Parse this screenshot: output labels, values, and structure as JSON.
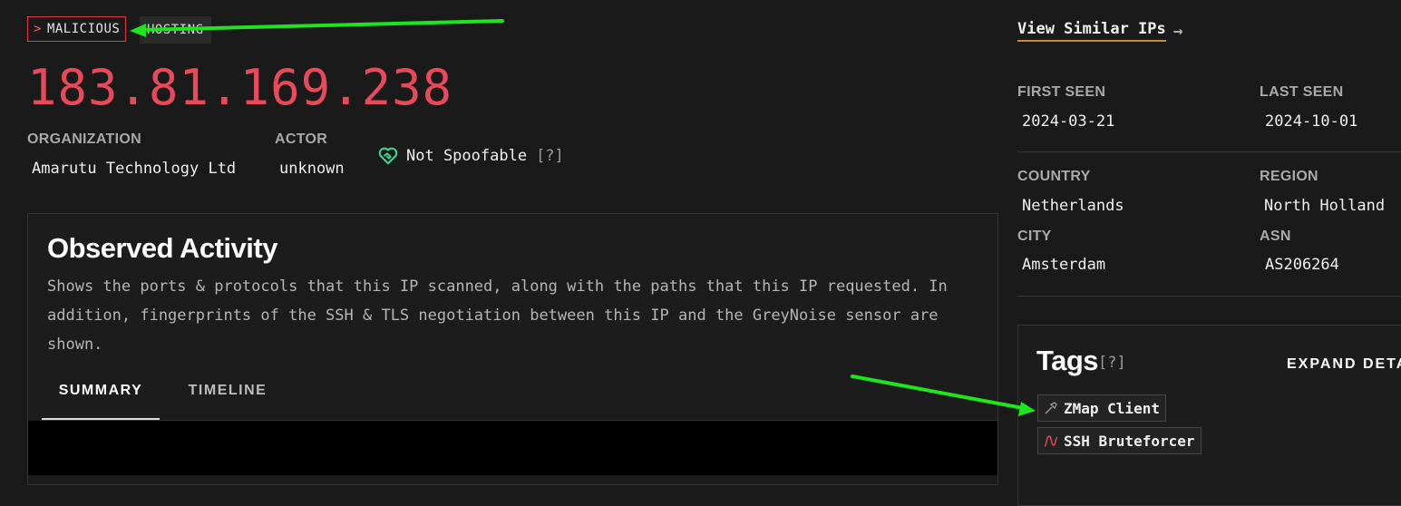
{
  "badges": {
    "classification_chevron": ">",
    "classification": "MALICIOUS",
    "category": "HOSTING"
  },
  "ip": "183.81.169.238",
  "details": {
    "organization_label": "ORGANIZATION",
    "organization_value": "Amarutu Technology Ltd",
    "actor_label": "ACTOR",
    "actor_value": "unknown",
    "spoofable_text": "Not Spoofable",
    "help_marker": "[?]"
  },
  "observed_activity": {
    "title": "Observed Activity",
    "description": "Shows the ports & protocols that this IP scanned, along with the paths that this IP requested. In addition, fingerprints of the SSH & TLS negotiation between this IP and the GreyNoise sensor are shown.",
    "tabs": [
      {
        "label": "SUMMARY",
        "active": true
      },
      {
        "label": "TIMELINE",
        "active": false
      }
    ]
  },
  "sidebar": {
    "similar_link": "View Similar IPs",
    "similar_arrow": "→",
    "first_seen_label": "FIRST SEEN",
    "first_seen_value": "2024-03-21",
    "last_seen_label": "LAST SEEN",
    "last_seen_value": "2024-10-01",
    "country_label": "COUNTRY",
    "country_value": "Netherlands",
    "region_label": "REGION",
    "region_value": "North Holland",
    "city_label": "CITY",
    "city_value": "Amsterdam",
    "asn_label": "ASN",
    "asn_value": "AS206264"
  },
  "tags": {
    "title": "Tags",
    "help_marker": "[?]",
    "expand_label": "EXPAND DETAILS",
    "items": [
      {
        "label": "ZMap Client",
        "icon": "tool-icon"
      },
      {
        "label": "SSH Bruteforcer",
        "icon": "wave-icon"
      }
    ]
  },
  "colors": {
    "malicious": "#e84a5b",
    "accent_underline": "#c68a32",
    "spoof_icon": "#3ddc97",
    "annotation_arrow": "#1ee51e"
  }
}
